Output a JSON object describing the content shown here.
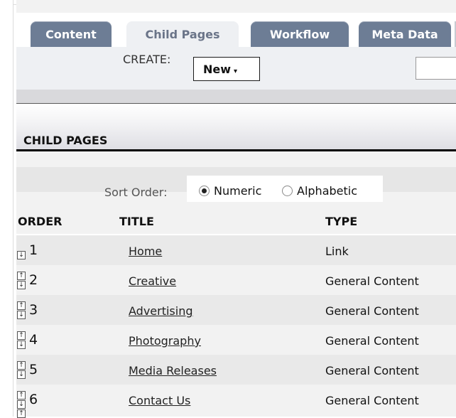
{
  "tabs": [
    {
      "label": "Content",
      "active": false
    },
    {
      "label": "Child Pages",
      "active": true
    },
    {
      "label": "Workflow",
      "active": false
    },
    {
      "label": "Meta Data",
      "active": false
    }
  ],
  "toolbar": {
    "create_label": "CREATE:",
    "new_button_label": "New",
    "new_button_caret": "▾"
  },
  "section": {
    "title": "CHILD PAGES"
  },
  "sort": {
    "label": "Sort Order:",
    "options": [
      {
        "label": "Numeric",
        "selected": true
      },
      {
        "label": "Alphabetic",
        "selected": false
      }
    ]
  },
  "table": {
    "headers": {
      "order": "ORDER",
      "title": "TITLE",
      "type": "TYPE"
    },
    "rows": [
      {
        "order": "1",
        "title": "Home",
        "type": "Link"
      },
      {
        "order": "2",
        "title": "Creative",
        "type": "General Content"
      },
      {
        "order": "3",
        "title": "Advertising",
        "type": "General Content"
      },
      {
        "order": "4",
        "title": "Photography",
        "type": "General Content"
      },
      {
        "order": "5",
        "title": "Media Releases",
        "type": "General Content"
      },
      {
        "order": "6",
        "title": "Contact Us",
        "type": "General Content"
      }
    ]
  },
  "icons": {
    "move_up": "move-up-icon",
    "move_down": "move-down-icon"
  },
  "colors": {
    "tab_bg": "#6d7d95",
    "tab_active_bg": "#eef0f3",
    "panel_bg": "#f2f2f2"
  }
}
